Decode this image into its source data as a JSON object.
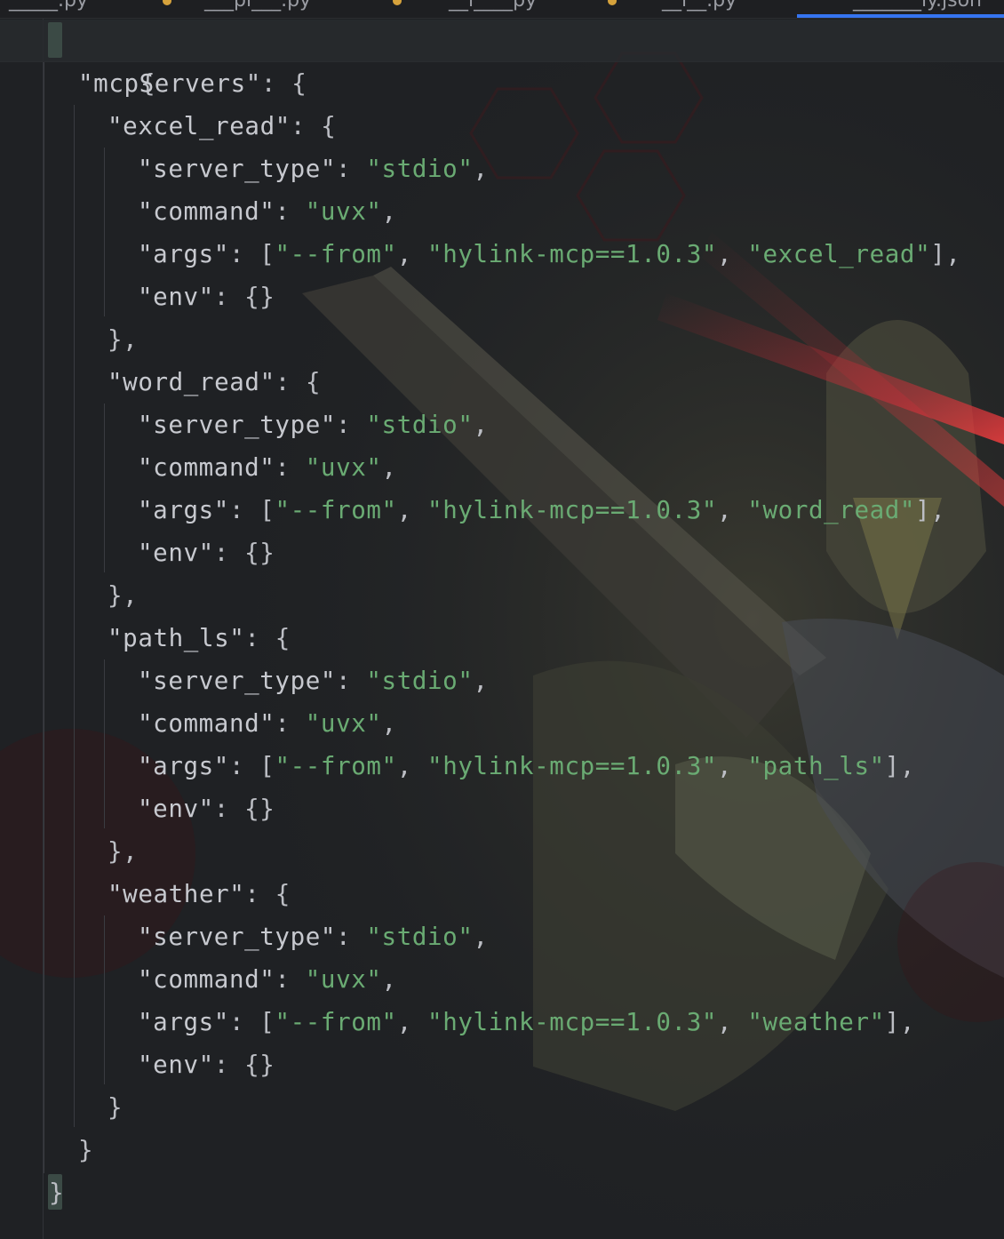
{
  "editor": {
    "tabs": [
      {
        "label": "_____.py"
      },
      {
        "label": "___pl___.py"
      },
      {
        "label": "__l____py"
      },
      {
        "label": "__l__.py"
      },
      {
        "label": "_______ly.json"
      }
    ],
    "colors": {
      "background": "#1f2124",
      "string": "#6aab73",
      "text": "#bcbec4",
      "active_tab_underline": "#3574f0"
    }
  },
  "code": {
    "root_open": "{",
    "root_close": "}",
    "mcp_key": "\"mcpServers\"",
    "mcp_close": "}",
    "servers": [
      {
        "name_key": "\"excel_read\"",
        "server_type_key": "\"server_type\"",
        "server_type_value": "\"stdio\"",
        "command_key": "\"command\"",
        "command_value": "\"uvx\"",
        "args_key": "\"args\"",
        "args_values": [
          "\"--from\"",
          "\"hylink-mcp==1.0.3\"",
          "\"excel_read\""
        ],
        "env_key": "\"env\"",
        "env_value": "{}",
        "close": "},"
      },
      {
        "name_key": "\"word_read\"",
        "server_type_key": "\"server_type\"",
        "server_type_value": "\"stdio\"",
        "command_key": "\"command\"",
        "command_value": "\"uvx\"",
        "args_key": "\"args\"",
        "args_values": [
          "\"--from\"",
          "\"hylink-mcp==1.0.3\"",
          "\"word_read\""
        ],
        "env_key": "\"env\"",
        "env_value": "{}",
        "close": "},"
      },
      {
        "name_key": "\"path_ls\"",
        "server_type_key": "\"server_type\"",
        "server_type_value": "\"stdio\"",
        "command_key": "\"command\"",
        "command_value": "\"uvx\"",
        "args_key": "\"args\"",
        "args_values": [
          "\"--from\"",
          "\"hylink-mcp==1.0.3\"",
          "\"path_ls\""
        ],
        "env_key": "\"env\"",
        "env_value": "{}",
        "close": "},"
      },
      {
        "name_key": "\"weather\"",
        "server_type_key": "\"server_type\"",
        "server_type_value": "\"stdio\"",
        "command_key": "\"command\"",
        "command_value": "\"uvx\"",
        "args_key": "\"args\"",
        "args_values": [
          "\"--from\"",
          "\"hylink-mcp==1.0.3\"",
          "\"weather\""
        ],
        "env_key": "\"env\"",
        "env_value": "{}",
        "close": "}"
      }
    ]
  }
}
